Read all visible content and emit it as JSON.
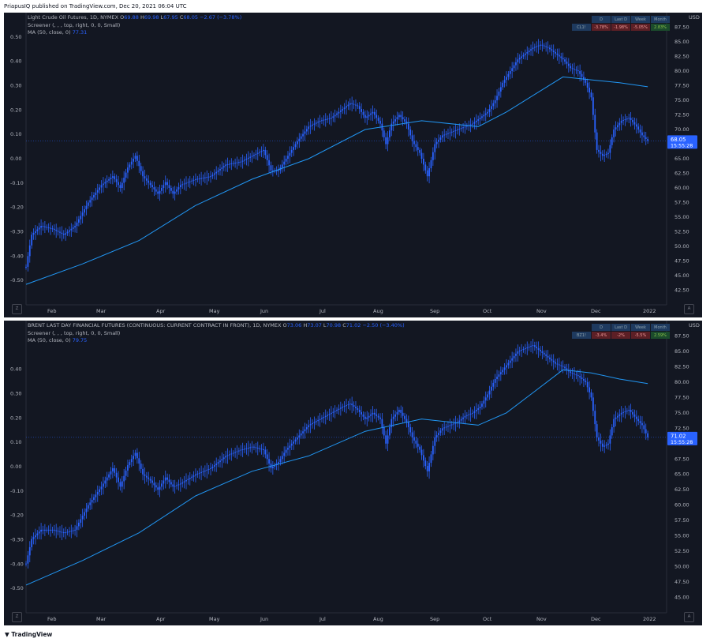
{
  "publish_bar": "PriapusIQ published on TradingView.com, Dec 20, 2021 06:04 UTC",
  "footer_brand": "TradingView",
  "colors": {
    "background": "#131722",
    "candle": "#2962ff",
    "ma_line": "#2196f3",
    "grid": "#1e222d",
    "axis_text": "#b2b5be",
    "price_label": "#2962ff"
  },
  "chart_data": [
    {
      "type": "candlestick",
      "title_prefix": "Light Crude Oil Futures, 1D, NYMEX",
      "ohlc": {
        "O": "69.88",
        "H": "69.98",
        "L": "67.95",
        "C": "68.05",
        "change": "−2.67 (−3.78%)"
      },
      "legend_lines": [
        "Screener (, , , top, right, 0, 0, Small)",
        "MA (50, close, 0)"
      ],
      "ma_value": "77.31",
      "currency": "USD",
      "right_axis": {
        "range": [
          40.0,
          90.0
        ],
        "ticks": [
          "90.00",
          "87.50",
          "85.00",
          "82.50",
          "80.00",
          "77.50",
          "75.00",
          "72.50",
          "70.00",
          "67.50",
          "65.00",
          "62.50",
          "60.00",
          "57.50",
          "55.00",
          "52.50",
          "50.00",
          "47.50",
          "45.00",
          "42.50",
          "40.00"
        ]
      },
      "left_axis": {
        "range": [
          -0.6,
          0.6
        ],
        "ticks": [
          "0.60",
          "0.50",
          "0.40",
          "0.30",
          "0.20",
          "0.10",
          "0.00",
          "-0.10",
          "-0.20",
          "-0.30",
          "-0.40",
          "-0.50"
        ]
      },
      "x_ticks": [
        "Feb",
        "Mar",
        "Apr",
        "May",
        "Jun",
        "Jul",
        "Aug",
        "Sep",
        "Oct",
        "Nov",
        "Dec",
        "2022"
      ],
      "last_price": "68.05",
      "countdown": "15:55:28",
      "screener": {
        "headers": [
          "D",
          "Last D",
          "Week",
          "Month"
        ],
        "symbol": "CL1!",
        "values": [
          "-3.78%",
          "-1.98%",
          "-5.05%",
          "2.83%"
        ],
        "signs": [
          "neg",
          "neg",
          "neg",
          "pos"
        ]
      },
      "close_points": [
        [
          0,
          46.5
        ],
        [
          3,
          52.0
        ],
        [
          8,
          53.5
        ],
        [
          14,
          53.0
        ],
        [
          20,
          52.0
        ],
        [
          26,
          53.5
        ],
        [
          33,
          57.5
        ],
        [
          40,
          60.5
        ],
        [
          46,
          62.0
        ],
        [
          50,
          60.0
        ],
        [
          54,
          63.5
        ],
        [
          58,
          65.5
        ],
        [
          62,
          62.0
        ],
        [
          66,
          60.5
        ],
        [
          70,
          59.0
        ],
        [
          74,
          61.0
        ],
        [
          78,
          59.0
        ],
        [
          82,
          60.5
        ],
        [
          90,
          61.5
        ],
        [
          98,
          62.0
        ],
        [
          106,
          64.0
        ],
        [
          114,
          64.5
        ],
        [
          120,
          65.5
        ],
        [
          126,
          66.5
        ],
        [
          130,
          63.0
        ],
        [
          134,
          63.0
        ],
        [
          138,
          65.0
        ],
        [
          144,
          68.0
        ],
        [
          150,
          70.5
        ],
        [
          156,
          71.5
        ],
        [
          162,
          72.0
        ],
        [
          168,
          73.5
        ],
        [
          172,
          74.5
        ],
        [
          176,
          74.0
        ],
        [
          180,
          72.0
        ],
        [
          184,
          73.0
        ],
        [
          188,
          71.0
        ],
        [
          191,
          67.5
        ],
        [
          194,
          71.0
        ],
        [
          198,
          72.5
        ],
        [
          202,
          71.0
        ],
        [
          205,
          68.0
        ],
        [
          209,
          66.0
        ],
        [
          213,
          62.0
        ],
        [
          217,
          67.5
        ],
        [
          221,
          69.0
        ],
        [
          225,
          69.5
        ],
        [
          229,
          70.0
        ],
        [
          233,
          70.5
        ],
        [
          237,
          71.0
        ],
        [
          241,
          72.0
        ],
        [
          245,
          73.0
        ],
        [
          249,
          75.0
        ],
        [
          253,
          78.0
        ],
        [
          257,
          80.0
        ],
        [
          261,
          82.0
        ],
        [
          265,
          83.0
        ],
        [
          269,
          84.0
        ],
        [
          273,
          84.5
        ],
        [
          277,
          84.0
        ],
        [
          281,
          83.0
        ],
        [
          285,
          82.0
        ],
        [
          289,
          80.5
        ],
        [
          293,
          80.0
        ],
        [
          297,
          78.0
        ],
        [
          300,
          75.5
        ],
        [
          303,
          66.5
        ],
        [
          306,
          65.5
        ],
        [
          309,
          66.0
        ],
        [
          312,
          70.0
        ],
        [
          316,
          71.5
        ],
        [
          320,
          72.0
        ],
        [
          324,
          70.5
        ],
        [
          327,
          69.0
        ],
        [
          330,
          68.05
        ]
      ],
      "ma_points": [
        [
          0,
          43.5
        ],
        [
          30,
          47.0
        ],
        [
          60,
          51.0
        ],
        [
          90,
          57.0
        ],
        [
          120,
          61.5
        ],
        [
          150,
          65.0
        ],
        [
          180,
          70.0
        ],
        [
          210,
          71.5
        ],
        [
          240,
          70.5
        ],
        [
          255,
          73.0
        ],
        [
          270,
          76.0
        ],
        [
          285,
          79.0
        ],
        [
          300,
          78.5
        ],
        [
          315,
          78.0
        ],
        [
          330,
          77.31
        ]
      ]
    },
    {
      "type": "candlestick",
      "title_prefix": "BRENT LAST DAY FINANCIAL FUTURES (CONTINUOUS: CURRENT CONTRACT IN FRONT), 1D, NYMEX",
      "ohlc": {
        "O": "73.06",
        "H": "73.07",
        "L": "70.98",
        "C": "71.02",
        "change": "−2.50 (−3.40%)"
      },
      "legend_lines": [
        "Screener (, , , top, right, 0, 0, Small)",
        "MA (50, close, 0)"
      ],
      "ma_value": "79.75",
      "currency": "USD",
      "right_axis": {
        "range": [
          42.5,
          90.0
        ],
        "ticks": [
          "90.00",
          "87.50",
          "85.00",
          "82.50",
          "80.00",
          "77.50",
          "75.00",
          "72.50",
          "70.00",
          "67.50",
          "65.00",
          "62.50",
          "60.00",
          "57.50",
          "55.00",
          "52.50",
          "50.00",
          "47.50",
          "45.00"
        ]
      },
      "left_axis": {
        "range": [
          -0.6,
          0.6
        ],
        "ticks": [
          "0.40",
          "0.30",
          "0.20",
          "0.10",
          "0.00",
          "-0.10",
          "-0.20",
          "-0.30",
          "-0.40",
          "-0.50"
        ]
      },
      "x_ticks": [
        "Feb",
        "Mar",
        "Apr",
        "May",
        "Jun",
        "Jul",
        "Aug",
        "Sep",
        "Oct",
        "Nov",
        "Dec",
        "2022"
      ],
      "last_price": "71.02",
      "countdown": "15:55:28",
      "screener": {
        "headers": [
          "D",
          "Last D",
          "Week",
          "Month"
        ],
        "symbol": "BZ1!",
        "values": [
          "-3.4%",
          "-2%",
          "-5.5%",
          "2.59%"
        ],
        "signs": [
          "neg",
          "neg",
          "neg",
          "pos"
        ]
      },
      "close_points": [
        [
          0,
          50.5
        ],
        [
          3,
          54.5
        ],
        [
          8,
          56.0
        ],
        [
          14,
          56.0
        ],
        [
          20,
          55.5
        ],
        [
          26,
          56.0
        ],
        [
          33,
          60.0
        ],
        [
          40,
          63.0
        ],
        [
          46,
          66.0
        ],
        [
          50,
          63.0
        ],
        [
          54,
          66.5
        ],
        [
          58,
          68.5
        ],
        [
          62,
          65.0
        ],
        [
          66,
          64.0
        ],
        [
          70,
          62.5
        ],
        [
          74,
          64.5
        ],
        [
          78,
          63.0
        ],
        [
          82,
          63.5
        ],
        [
          90,
          65.0
        ],
        [
          98,
          66.0
        ],
        [
          106,
          68.0
        ],
        [
          114,
          69.0
        ],
        [
          120,
          69.5
        ],
        [
          126,
          69.0
        ],
        [
          130,
          66.0
        ],
        [
          134,
          67.0
        ],
        [
          138,
          69.0
        ],
        [
          144,
          71.0
        ],
        [
          150,
          73.0
        ],
        [
          156,
          74.0
        ],
        [
          162,
          75.0
        ],
        [
          168,
          76.0
        ],
        [
          172,
          76.5
        ],
        [
          176,
          75.5
        ],
        [
          180,
          74.0
        ],
        [
          184,
          75.0
        ],
        [
          188,
          74.0
        ],
        [
          191,
          70.0
        ],
        [
          194,
          74.0
        ],
        [
          198,
          75.5
        ],
        [
          202,
          73.5
        ],
        [
          205,
          71.0
        ],
        [
          209,
          69.0
        ],
        [
          213,
          65.5
        ],
        [
          217,
          71.0
        ],
        [
          221,
          72.5
        ],
        [
          225,
          73.0
        ],
        [
          229,
          73.5
        ],
        [
          233,
          74.5
        ],
        [
          237,
          75.0
        ],
        [
          241,
          76.0
        ],
        [
          245,
          78.0
        ],
        [
          249,
          80.5
        ],
        [
          253,
          82.0
        ],
        [
          257,
          83.5
        ],
        [
          261,
          85.0
        ],
        [
          265,
          85.5
        ],
        [
          269,
          86.0
        ],
        [
          273,
          85.0
        ],
        [
          277,
          84.0
        ],
        [
          281,
          83.0
        ],
        [
          285,
          82.5
        ],
        [
          289,
          81.5
        ],
        [
          293,
          81.0
        ],
        [
          297,
          80.0
        ],
        [
          300,
          77.5
        ],
        [
          303,
          71.0
        ],
        [
          306,
          69.5
        ],
        [
          309,
          70.0
        ],
        [
          312,
          74.0
        ],
        [
          316,
          75.0
        ],
        [
          320,
          75.5
        ],
        [
          324,
          74.0
        ],
        [
          327,
          73.0
        ],
        [
          330,
          71.02
        ]
      ],
      "ma_points": [
        [
          0,
          47.0
        ],
        [
          30,
          51.0
        ],
        [
          60,
          55.5
        ],
        [
          90,
          61.5
        ],
        [
          120,
          65.5
        ],
        [
          150,
          68.0
        ],
        [
          180,
          72.0
        ],
        [
          210,
          74.0
        ],
        [
          240,
          73.0
        ],
        [
          255,
          75.0
        ],
        [
          270,
          78.5
        ],
        [
          285,
          82.0
        ],
        [
          300,
          81.5
        ],
        [
          315,
          80.5
        ],
        [
          330,
          79.75
        ]
      ]
    }
  ]
}
